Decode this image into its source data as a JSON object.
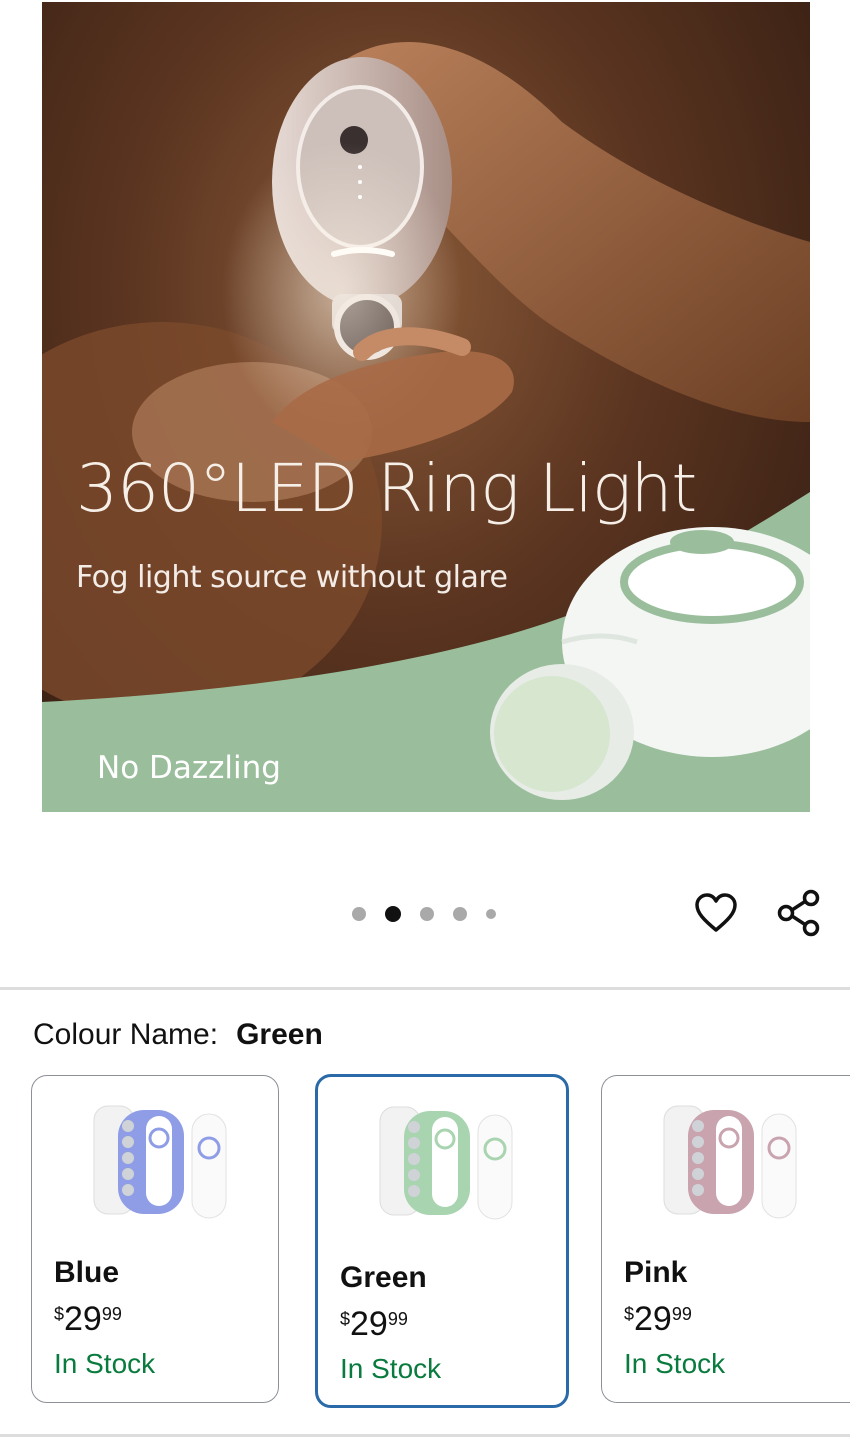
{
  "hero": {
    "headline": "360°LED Ring Light",
    "subheadline": "Fog light source without glare",
    "badge": "No Dazzling"
  },
  "carousel": {
    "total": 5,
    "active_index": 1
  },
  "actions": {
    "favorite_icon": "heart-icon",
    "share_icon": "share-icon"
  },
  "colour": {
    "label": "Colour Name:",
    "selected": "Green"
  },
  "swatches": [
    {
      "name": "Blue",
      "currency": "$",
      "price_whole": "29",
      "price_fraction": "99",
      "stock": "In Stock",
      "accent": "#8e9de6"
    },
    {
      "name": "Green",
      "currency": "$",
      "price_whole": "29",
      "price_fraction": "99",
      "stock": "In Stock",
      "accent": "#a9d4b0"
    },
    {
      "name": "Pink",
      "currency": "$",
      "price_whole": "29",
      "price_fraction": "99",
      "stock": "In Stock",
      "accent": "#c9a3ae"
    }
  ],
  "colors": {
    "stock_green": "#0a7b3e",
    "selected_border": "#2a6aa8",
    "hero_green": "#9abe9c"
  }
}
